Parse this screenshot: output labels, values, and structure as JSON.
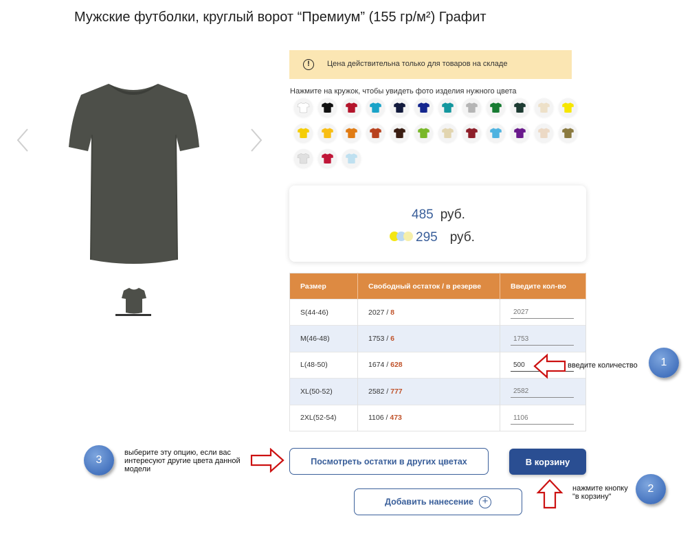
{
  "page": {
    "title": "Мужские футболки, круглый ворот “Премиум” (155 гр/м²) Графит"
  },
  "gallery": {
    "prev_icon": "chevron-left-icon",
    "next_icon": "chevron-right-icon",
    "selected_color": "#4d4f49"
  },
  "notice": {
    "icon": "exclamation-circle-icon",
    "text": "Цена действительна только для товаров на складе"
  },
  "colors": {
    "hint": "Нажмите на кружок, чтобы увидеть фото изделия нужного цвета",
    "swatches": [
      "#ffffff",
      "#111111",
      "#b3142b",
      "#1aa3c8",
      "#121a3d",
      "#14268e",
      "#14979e",
      "#b5b5b5",
      "#177b32",
      "#1d3b32",
      "#ede0c8",
      "#f6e600",
      "#f5cd06",
      "#f8be15",
      "#e07b13",
      "#b8421e",
      "#3a1d12",
      "#79b829",
      "#e2d5b0",
      "#8e1f2a",
      "#4fb3e0",
      "#6a1a8c",
      "#ecd9c5",
      "#8b7a40",
      "#e0e0e0",
      "#c01638",
      "#bfe0f0"
    ]
  },
  "pricing": {
    "price": "485",
    "currency": "руб.",
    "print_price": "295",
    "print_currency": "руб.",
    "print_dots": [
      "#f4e614",
      "#bcd9f2",
      "#f6efaa"
    ]
  },
  "stock_table": {
    "headers": [
      "Размер",
      "Свободный остаток / в резерве",
      "Введите кол-во"
    ],
    "rows": [
      {
        "size": "S(44-46)",
        "free": "2027",
        "reserve": "8",
        "qty": "",
        "placeholder": "2027"
      },
      {
        "size": "M(46-48)",
        "free": "1753",
        "reserve": "6",
        "qty": "",
        "placeholder": "1753"
      },
      {
        "size": "L(48-50)",
        "free": "1674",
        "reserve": "628",
        "qty": "500",
        "placeholder": "1674"
      },
      {
        "size": "XL(50-52)",
        "free": "2582",
        "reserve": "777",
        "qty": "",
        "placeholder": "2582"
      },
      {
        "size": "2XL(52-54)",
        "free": "1106",
        "reserve": "473",
        "qty": "",
        "placeholder": "1106"
      }
    ]
  },
  "buttons": {
    "other_colors": "Посмотреть остатки в других цветах",
    "add_to_cart": "В корзину",
    "add_print": "Добавить нанесение"
  },
  "annotations": {
    "step1": {
      "number": "1",
      "text": "введите количество"
    },
    "step2": {
      "number": "2",
      "text": "нажмите кнопку \"в корзину\""
    },
    "step3": {
      "number": "3",
      "text": "выберите эту опцию, если вас интересуют другие цвета данной модели"
    },
    "arrow_color": "#cc1111"
  }
}
